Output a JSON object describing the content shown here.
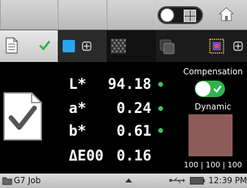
{
  "measurement": {
    "rows": [
      {
        "label": "L*",
        "value": "94.18",
        "pass": true
      },
      {
        "label": "a*",
        "value": "0.24",
        "pass": true
      },
      {
        "label": "b*",
        "value": "0.61",
        "pass": true
      },
      {
        "label": "ΔE00",
        "value": "0.16",
        "pass": false
      }
    ]
  },
  "compensation": {
    "label": "Compensation",
    "enabled": true,
    "mode_label": "Dynamic",
    "swatch_color": "#8d5c5a",
    "rgb_label": "100 | 100 | 100"
  },
  "status": {
    "job_label": "G7 Job",
    "time": "12:39 PM"
  },
  "colors": {
    "accent_green": "#3ec55a",
    "accent_blue": "#2aa5f0"
  }
}
